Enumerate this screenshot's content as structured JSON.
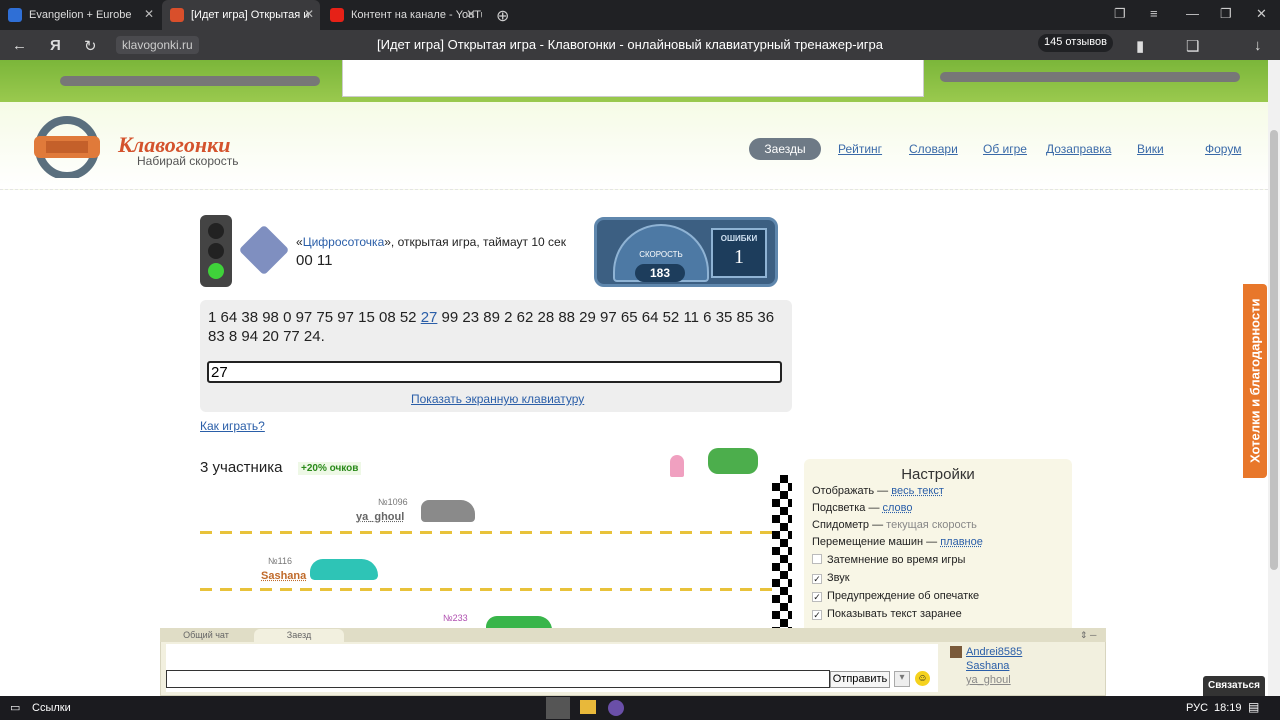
{
  "browser": {
    "tabs": [
      {
        "label": "Evangelion + Eurobe",
        "color": "#2f6fd6"
      },
      {
        "label": "[Идет игра] Открытая и",
        "color": "#d94f2b"
      },
      {
        "label": "Контент на канале - YouTu",
        "color": "#e62117"
      }
    ],
    "url": "klavogonki.ru",
    "title": "[Идет игра] Открытая игра - Клавогонки - онлайновый клавиатурный тренажер-игра",
    "reviews": "145 отзывов"
  },
  "site": {
    "logo_name": "Клавогонки",
    "logo_tagline": "Набирай скорость",
    "menu": [
      "Заезды",
      "Рейтинг",
      "Словари",
      "Об игре",
      "Дозаправка",
      "Вики",
      "Форум"
    ]
  },
  "game": {
    "quote_open": "«",
    "vocab": "Цифросоточка",
    "info_rest": "», открытая игра, таймаут 10 сек",
    "timer": "00 11",
    "speed_label": "СКОРОСТЬ",
    "speed": "183",
    "errors_label": "ОШИБКИ",
    "errors": "1",
    "text_before": "1 64 38 98 0 97 75 97 15 08 52 ",
    "text_current": "27",
    "text_after": " 99 23 89 2 62 28 88 29 97 65 64 52 11 6 35 85 36 83 8 94 20 77 24.",
    "input_value": "27",
    "keyboard_link": "Показать экранную клавиатуру",
    "howto": "Как играть?",
    "participants": "3 участника",
    "bonus": "+20% очков",
    "players": [
      {
        "rank": "№1096",
        "name": "ya_ghoul",
        "color": "#8a8a8a"
      },
      {
        "rank": "№116",
        "name": "Sashana",
        "color": "#2ec4b6"
      },
      {
        "rank": "№233",
        "name": "",
        "color": "#39b54a"
      }
    ]
  },
  "settings": {
    "title": "Настройки",
    "rows": [
      {
        "label": "Отображать — ",
        "value": "весь текст"
      },
      {
        "label": "Подсветка — ",
        "value": "слово"
      },
      {
        "label": "Спидометр — ",
        "value": "текущая скорость"
      },
      {
        "label": "Перемещение машин — ",
        "value": "плавное"
      }
    ],
    "checks": [
      {
        "label": "Затемнение во время игры",
        "checked": false
      },
      {
        "label": "Звук",
        "checked": true
      },
      {
        "label": "Предупреждение об опечатке",
        "checked": true
      },
      {
        "label": "Показывать текст заранее",
        "checked": true
      }
    ]
  },
  "side_tab": "Хотелки и благодарности",
  "chat": {
    "tabs": [
      "Общий чат",
      "Заезд"
    ],
    "send": "Отправить",
    "users": [
      "Andrei8585",
      "Sashana",
      "ya_ghoul"
    ],
    "contact": "Связаться"
  },
  "taskbar": {
    "links": "Ссылки",
    "lang": "РУС",
    "time": "18:19"
  }
}
